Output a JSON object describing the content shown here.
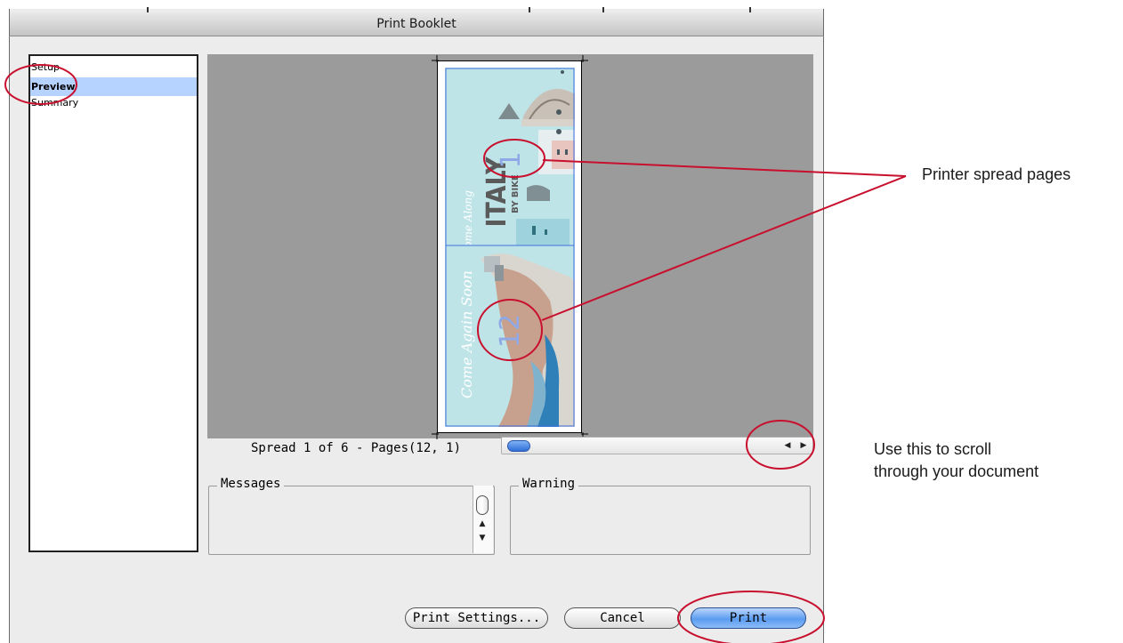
{
  "window": {
    "title": "Print Booklet"
  },
  "sidebar": {
    "items": [
      {
        "label": "Setup",
        "selected": false
      },
      {
        "label": "Preview",
        "selected": true
      },
      {
        "label": "Summary",
        "selected": false
      }
    ]
  },
  "preview": {
    "spread_label": "Spread 1 of 6 - Pages(12, 1)",
    "spread_position": 0.0,
    "pages": [
      {
        "number": "1",
        "script_text": "Come Along",
        "title_text": "ITALY",
        "subtitle_text": "BY BIKE"
      },
      {
        "number": "12",
        "script_text": "Come Again Soon"
      }
    ]
  },
  "messages": {
    "label": "Messages"
  },
  "warning": {
    "label": "Warning"
  },
  "buttons": {
    "print_settings": "Print Settings...",
    "cancel": "Cancel",
    "print": "Print"
  },
  "annotations": {
    "spread_pages": "Printer spread pages",
    "scroll_line1": "Use this to scroll",
    "scroll_line2": "through your document",
    "color": "#c8102e"
  },
  "colors": {
    "selection": "#b6d2ff",
    "preview_bg": "#9b9b9b",
    "page_bg": "#bfe4e8",
    "page_number": "#8fa8e6",
    "accent_blue": "#3f7fe0"
  }
}
